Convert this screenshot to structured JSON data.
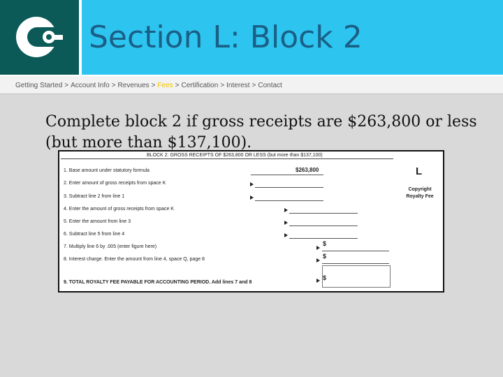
{
  "header": {
    "title": "Section L: Block 2",
    "logo_icon": "c-logo-icon",
    "logo_bg": "#0b5a58",
    "bar_color": "#2ec4f0",
    "title_color": "#1a5f86"
  },
  "breadcrumb": {
    "items": [
      "Getting Started",
      "Account Info",
      "Revenues",
      "Fees",
      "Certification",
      "Interest",
      "Contact"
    ],
    "separator": ">",
    "active_color": "#f2c300"
  },
  "body": {
    "text": "Complete block 2 if gross receipts are $263,800 or less (but more than $137,100)."
  },
  "form": {
    "header": "BLOCK 2: GROSS RECEIPTS OF $263,800 OR LESS (but more than $137,100)",
    "letter": "L",
    "side_label": "Copyright Royalty Fee",
    "dollar_sign": "$",
    "rows": [
      {
        "text": "1. Base amount under statutory formula",
        "amount": "$263,800"
      },
      {
        "text": "2. Enter amount of gross receipts from space K"
      },
      {
        "text": "3. Subtract line 2 from line 1"
      },
      {
        "text": "4. Enter the amount of gross receipts from space K"
      },
      {
        "text": "5. Enter the amount from line 3"
      },
      {
        "text": "6. Subtract line 5 from line 4"
      },
      {
        "text": "7. Multiply line 6 by .005 (enter figure here)"
      },
      {
        "text": "8. Interest charge. Enter the amount from line 4, space Q, page 8"
      },
      {
        "text": "9. TOTAL ROYALTY FEE PAYABLE FOR ACCOUNTING PERIOD. Add lines 7 and 8"
      }
    ]
  }
}
